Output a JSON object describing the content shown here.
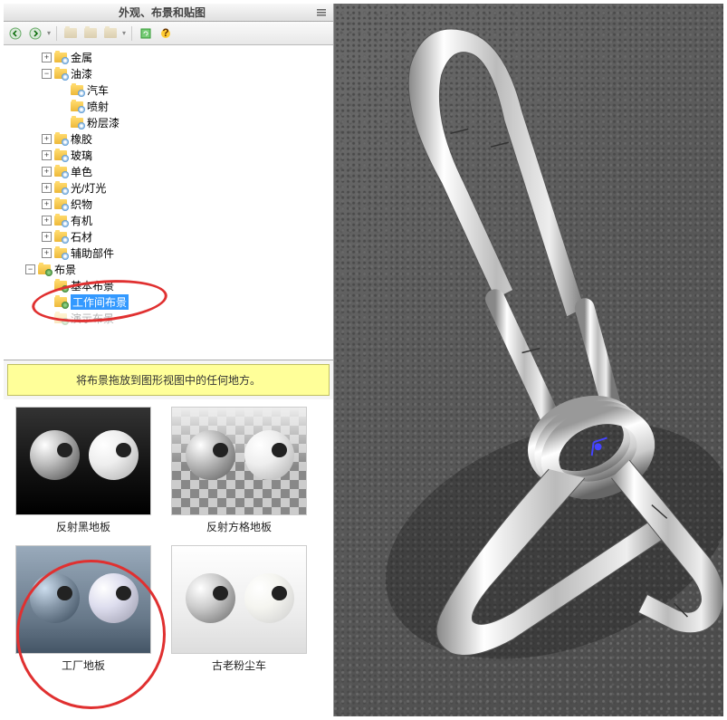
{
  "panel": {
    "title": "外观、布景和贴图"
  },
  "tree": {
    "root1_items": [
      {
        "label": "金属",
        "toggle": "+"
      },
      {
        "label": "油漆",
        "toggle": "-"
      }
    ],
    "paint_children": [
      {
        "label": "汽车"
      },
      {
        "label": "喷射"
      },
      {
        "label": "粉层漆"
      }
    ],
    "root1_items2": [
      {
        "label": "橡胶",
        "toggle": "+"
      },
      {
        "label": "玻璃",
        "toggle": "+"
      },
      {
        "label": "单色",
        "toggle": "+"
      },
      {
        "label": "光/灯光",
        "toggle": "+"
      },
      {
        "label": "织物",
        "toggle": "+"
      },
      {
        "label": "有机",
        "toggle": "+"
      },
      {
        "label": "石材",
        "toggle": "+"
      },
      {
        "label": "辅助部件",
        "toggle": "+"
      }
    ],
    "scene_root": {
      "label": "布景",
      "toggle": "-"
    },
    "scene_children": [
      {
        "label": "基本布景"
      },
      {
        "label": "工作间布景",
        "selected": true
      },
      {
        "label": "演示布景"
      }
    ]
  },
  "hint": "将布景拖放到图形视图中的任何地方。",
  "thumbs": [
    {
      "label": "反射黑地板"
    },
    {
      "label": "反射方格地板"
    },
    {
      "label": "工厂地板"
    },
    {
      "label": "古老粉尘车"
    }
  ]
}
